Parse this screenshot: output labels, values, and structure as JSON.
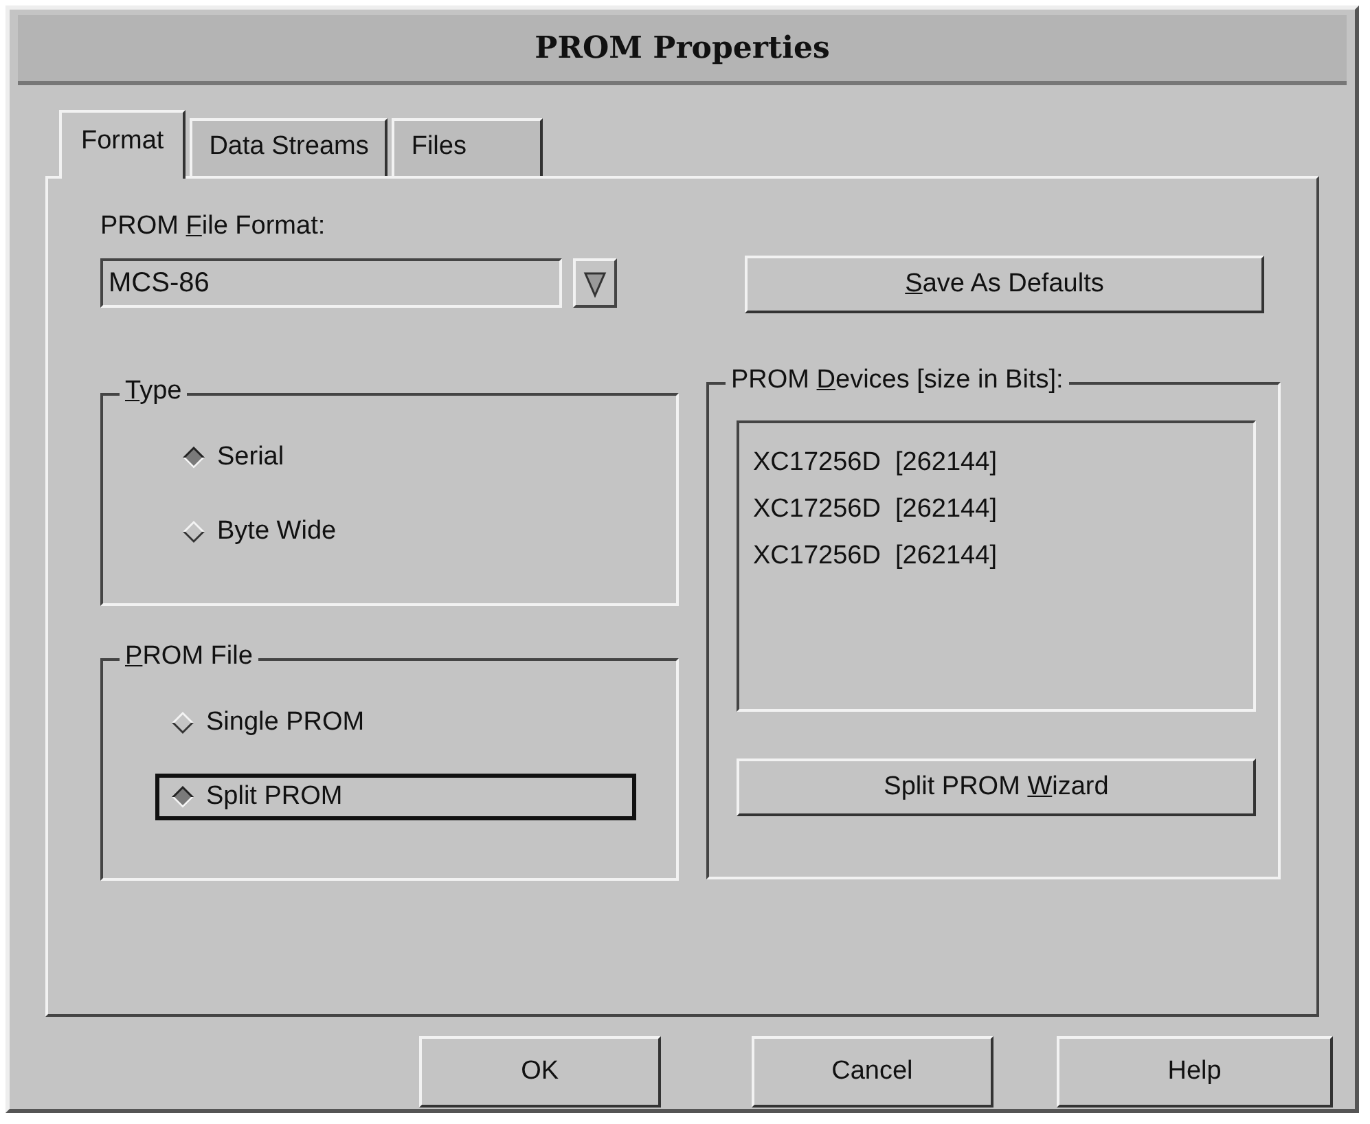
{
  "window": {
    "title": "PROM Properties"
  },
  "tabs": [
    {
      "label": "Format",
      "selected": true
    },
    {
      "label": "Data Streams",
      "selected": false
    },
    {
      "label": "Files",
      "selected": false
    }
  ],
  "file_format": {
    "label_parts": {
      "before": "PROM ",
      "key": "F",
      "after": "ile Format:"
    },
    "value": "MCS-86"
  },
  "save_defaults_button": {
    "label_parts": {
      "key": "S",
      "after": "ave As Defaults"
    }
  },
  "type_group": {
    "title_parts": {
      "key": "T",
      "after": "ype"
    },
    "options": [
      {
        "label": "Serial",
        "selected": true,
        "focused": false
      },
      {
        "label": "Byte Wide",
        "selected": false,
        "focused": false
      }
    ]
  },
  "prom_file_group": {
    "title_parts": {
      "key": "P",
      "after": "ROM File"
    },
    "options": [
      {
        "label": "Single PROM",
        "selected": false,
        "focused": false
      },
      {
        "label": "Split PROM",
        "selected": true,
        "focused": true
      }
    ]
  },
  "devices_group": {
    "title_parts": {
      "before": "PROM ",
      "key": "D",
      "after": "evices [size in Bits]:"
    },
    "devices": [
      {
        "name": "XC17256D",
        "size": "[262144]"
      },
      {
        "name": "XC17256D",
        "size": "[262144]"
      },
      {
        "name": "XC17256D",
        "size": "[262144]"
      }
    ],
    "wizard_button": {
      "label_parts": {
        "before": "Split PROM ",
        "key": "W",
        "after": "izard"
      }
    }
  },
  "buttons": [
    "OK",
    "Cancel",
    "Help"
  ]
}
